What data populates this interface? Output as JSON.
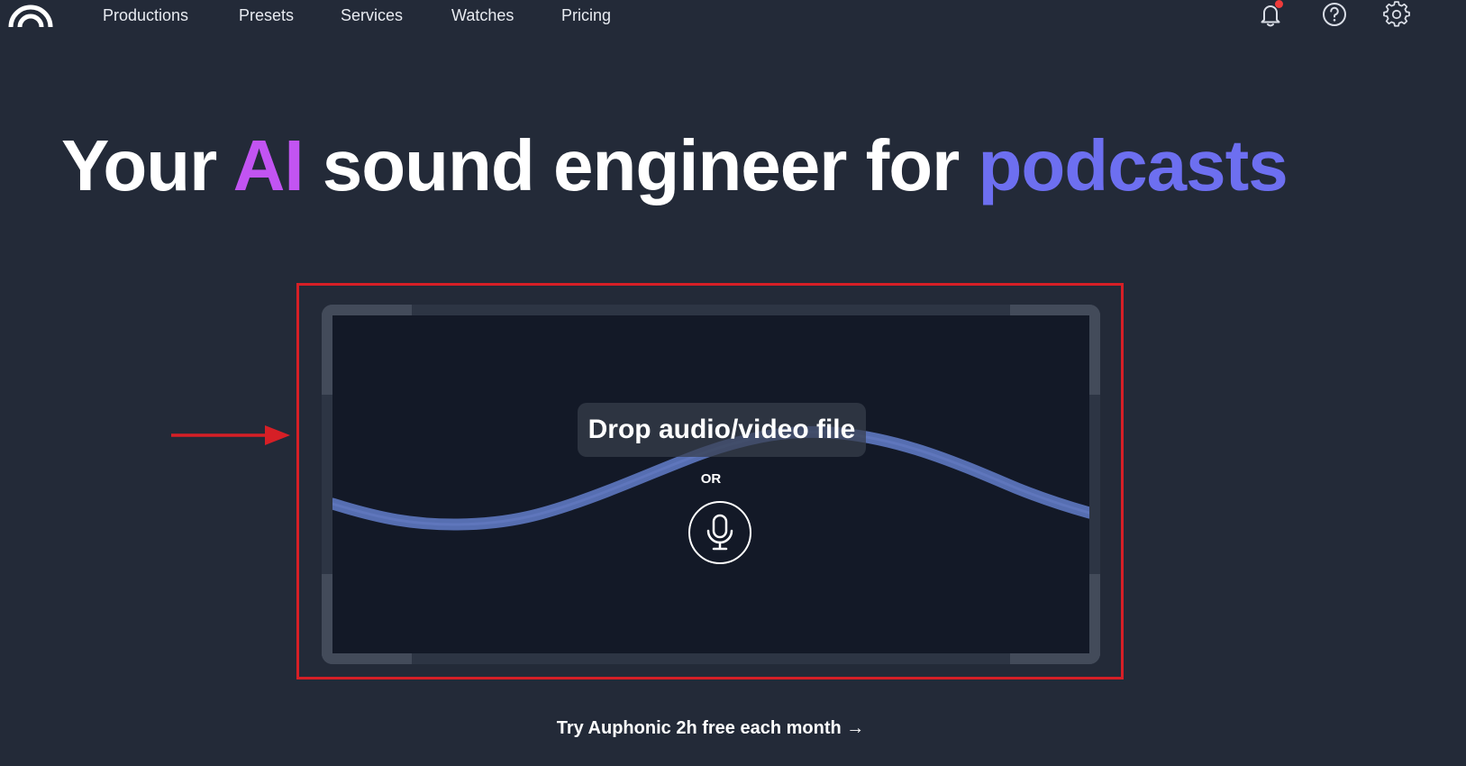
{
  "nav": {
    "logo_icon": "auphonic-logo-icon",
    "links": [
      "Productions",
      "Presets",
      "Services",
      "Watches",
      "Pricing"
    ],
    "icons": [
      "bell-icon",
      "help-icon",
      "gear-icon"
    ],
    "has_notification": true
  },
  "hero": {
    "title_prefix": "Your",
    "title_ai": "AI",
    "title_middle": "sound engineer for",
    "title_suffix": "podcasts"
  },
  "dropzone": {
    "label": "Drop audio/video file",
    "or_text": "OR",
    "record_icon": "microphone-icon"
  },
  "cta": {
    "label": "Try Auphonic 2h free each month →"
  },
  "annotation": {
    "highlight_color": "#d61f26",
    "arrow_icon": "arrow-right-icon"
  },
  "colors": {
    "background": "#232a38",
    "accent_ai": "#c254f2",
    "accent_podcasts": "#6d6ff0",
    "waveform": "#5b74bd",
    "dropzone_inner": "#131927"
  }
}
